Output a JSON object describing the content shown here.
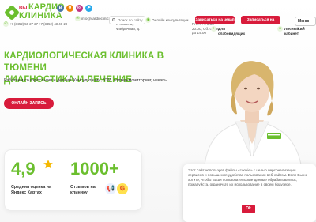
{
  "logo": {
    "superscript": "ВЫ",
    "line1": "КАРДИО",
    "line2": "КЛИНИКА"
  },
  "social": [
    {
      "icon": "vk-icon",
      "letter": "в",
      "color": "#4a76a8"
    },
    {
      "icon": "ok-icon",
      "letter": "о",
      "color": "#ee8208"
    },
    {
      "icon": "instagram-icon",
      "letter": "◎",
      "color": "#c13584"
    },
    {
      "icon": "telegram-icon",
      "letter": "➤",
      "color": "#29a9eb"
    }
  ],
  "header": {
    "phones": "+7 (3452) 56-27-27   +7 (3452) 43-46-28",
    "email": "info@cardioclinic.ru",
    "address": "г. Тюмень, Фабричная, д.7",
    "hours": "Пн-Пт: с 8:00-20:00, Сб: с 8:30 до 14:00",
    "search_placeholder": "Поиск по сайту",
    "online_consult": "Онлайн консультации",
    "book_exam": "Записаться на чекап",
    "book_appointment": "Записаться на прием",
    "menu": "Меню сай",
    "specials": "Для слабовидящих",
    "cabinet": "Личный кабинет"
  },
  "hero": {
    "title_line1": "КАРДИОЛОГИЧЕСКАЯ КЛИНИКА В ТЮМЕНИ",
    "title_line2": "ДИАГНОСТИКА И ЛЕЧЕНИЕ",
    "subtitle": "Работаем со взрослыми и детьми. Консультации, УЗИ, холтер-мониторинг, чекапы",
    "cta": "ОНЛАЙН ЗАПИСЬ"
  },
  "stats": {
    "rating": "4,9",
    "rating_label_1": "Средняя оценка на",
    "rating_label_2": "Яндекс Картах",
    "reviews": "1000+",
    "reviews_label_1": "Отзывов на",
    "reviews_label_2": "клинику"
  },
  "cookie": {
    "text": "Этот сайт использует файлы «cookie» с целью персонализации сервисов и повышения удобства пользования веб-сайтом. Если Вы не хотите, чтобы Ваши пользовательские данные обрабатывались, пожалуйста, ограничьте их использование в своем браузере.",
    "ok": "Ok"
  },
  "colors": {
    "brand_green": "#6bbf2e",
    "accent_red": "#d81b3b",
    "star": "#f5b800"
  }
}
